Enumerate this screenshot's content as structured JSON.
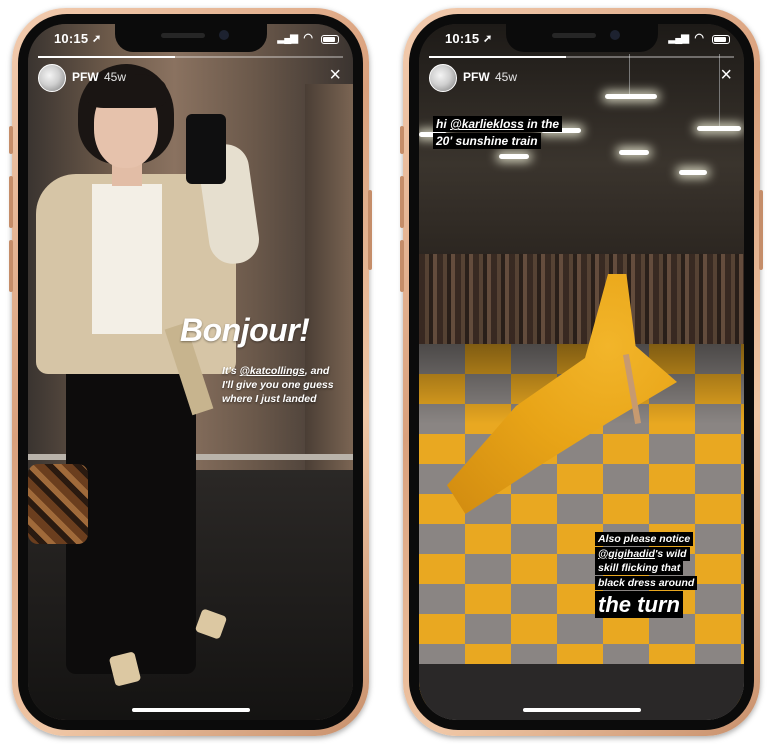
{
  "stories": [
    {
      "status": {
        "time": "10:15",
        "location_arrow": "➚"
      },
      "header": {
        "account": "PFW",
        "age": "45w",
        "close_icon": "×"
      },
      "progress": 0.45,
      "texts": {
        "headline": "Bonjour!",
        "caption_line1_pre": "It's ",
        "caption_mention": "@katcollings",
        "caption_line1_post": ", and",
        "caption_line2": "I'll give you one guess",
        "caption_line3": "where I just landed"
      }
    },
    {
      "status": {
        "time": "10:15",
        "location_arrow": "➚"
      },
      "header": {
        "account": "PFW",
        "age": "45w",
        "close_icon": "×"
      },
      "progress": 0.45,
      "texts": {
        "top_line1_pre": "hi ",
        "top_mention": "@karliekloss",
        "top_line1_post": " in the",
        "top_line2": "20' sunshine train",
        "bottom_line1": "Also please notice",
        "bottom_mention": "@gigihadid",
        "bottom_line2_post": "'s wild",
        "bottom_line3": "skill flicking that",
        "bottom_line4": "black dress around",
        "big": "the turn"
      }
    }
  ]
}
